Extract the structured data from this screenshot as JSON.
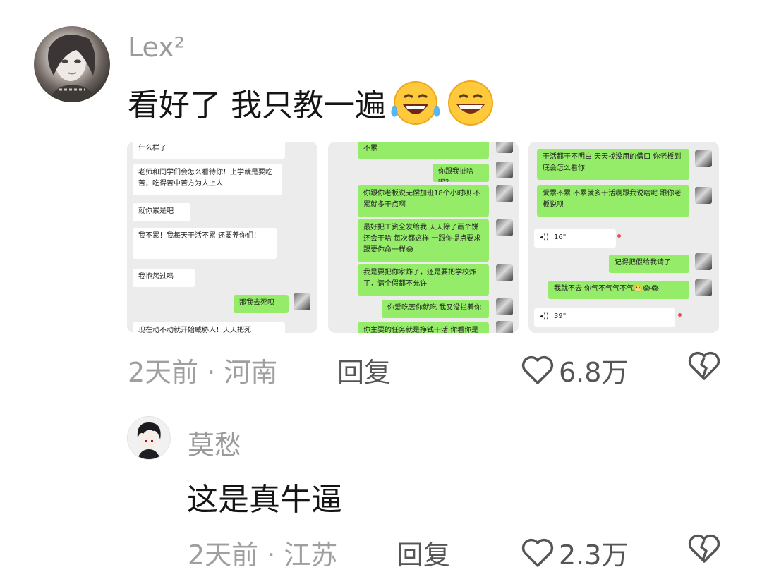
{
  "comments": [
    {
      "username": "Lex²",
      "text": "看好了 我只教一遍",
      "time_location": "2天前 · 河南",
      "reply_label": "回复",
      "likes": "6.8万",
      "emojis": [
        "laughing-tears-emoji",
        "grinning-emoji"
      ]
    },
    {
      "username": "莫愁",
      "text": "这是真牛逼",
      "time_location": "2天前 · 江苏",
      "reply_label": "回复",
      "likes": "2.3万"
    }
  ],
  "screenshots": [
    {
      "bubbles": [
        {
          "side": "left",
          "text": "什么样了"
        },
        {
          "side": "left",
          "text": "老师和同学们会怎么看待你！上学就是要吃苦，吃得苦中苦方为人上人"
        },
        {
          "side": "left",
          "text": "就你累是吧"
        },
        {
          "side": "left",
          "text": "我不累！我每天干活不累 还要养你们！"
        },
        {
          "side": "left",
          "text": "我抱怨过吗"
        },
        {
          "side": "right",
          "text": "那我去死呗"
        },
        {
          "side": "left",
          "text": "现在动不动就开始威胁人！天天把死"
        }
      ]
    },
    {
      "bubbles": [
        {
          "side": "right",
          "text": "不累"
        },
        {
          "side": "right",
          "text": "你跟我扯啥呢？"
        },
        {
          "side": "right",
          "text": "你跟你老板说无偿加班18个小时呗 不累就多干点啊"
        },
        {
          "side": "right",
          "text": "最好把工资全发给我 天天除了画个饼还会干啥 每次都这样 一跟你提点要求跟要你命一样😂"
        },
        {
          "side": "right",
          "text": "我是要把你家炸了，还是要把学校炸了，请个假都不允许"
        },
        {
          "side": "right",
          "text": "你爱吃苦你就吃 我又没拦着你"
        },
        {
          "side": "right",
          "text": "你主要的任务就是挣钱干活 你看你是"
        }
      ]
    },
    {
      "bubbles": [
        {
          "side": "right",
          "text": "干活都干不明白 天天找没用的借口 你老板到底会怎么看你"
        },
        {
          "side": "right",
          "text": "爱累不累 不累就多干活啊跟我说啥呢 跟你老板说呗"
        },
        {
          "side": "left",
          "text": "16\""
        },
        {
          "side": "right",
          "text": "记得把假给我请了"
        },
        {
          "side": "right",
          "text": "我就不去 你气不气气不气😬😂😂"
        },
        {
          "side": "left",
          "text": "39\""
        }
      ]
    }
  ],
  "icons": {
    "like": "heart-outline-icon",
    "dislike": "broken-heart-icon"
  },
  "colors": {
    "chat_green": "#95ec69",
    "chat_bg": "#ececec",
    "muted_text": "#9b9b9b"
  }
}
